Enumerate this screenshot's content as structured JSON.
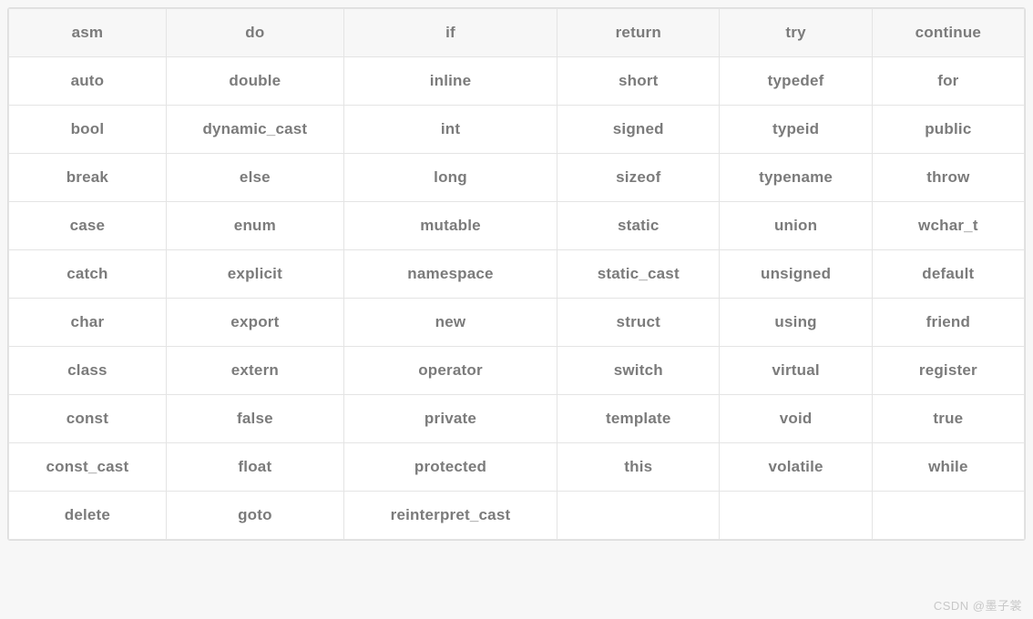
{
  "watermark": "CSDN @墨子裳",
  "table": {
    "header": [
      "asm",
      "do",
      "if",
      "return",
      "try",
      "continue"
    ],
    "rows": [
      [
        "auto",
        "double",
        "inline",
        "short",
        "typedef",
        "for"
      ],
      [
        "bool",
        "dynamic_cast",
        "int",
        "signed",
        "typeid",
        "public"
      ],
      [
        "break",
        "else",
        "long",
        "sizeof",
        "typename",
        "throw"
      ],
      [
        "case",
        "enum",
        "mutable",
        "static",
        "union",
        "wchar_t"
      ],
      [
        "catch",
        "explicit",
        "namespace",
        "static_cast",
        "unsigned",
        "default"
      ],
      [
        "char",
        "export",
        "new",
        "struct",
        "using",
        "friend"
      ],
      [
        "class",
        "extern",
        "operator",
        "switch",
        "virtual",
        "register"
      ],
      [
        "const",
        "false",
        "private",
        "template",
        "void",
        "true"
      ],
      [
        "const_cast",
        "float",
        "protected",
        "this",
        "volatile",
        "while"
      ],
      [
        "delete",
        "goto",
        "reinterpret_cast",
        "",
        "",
        ""
      ]
    ]
  }
}
